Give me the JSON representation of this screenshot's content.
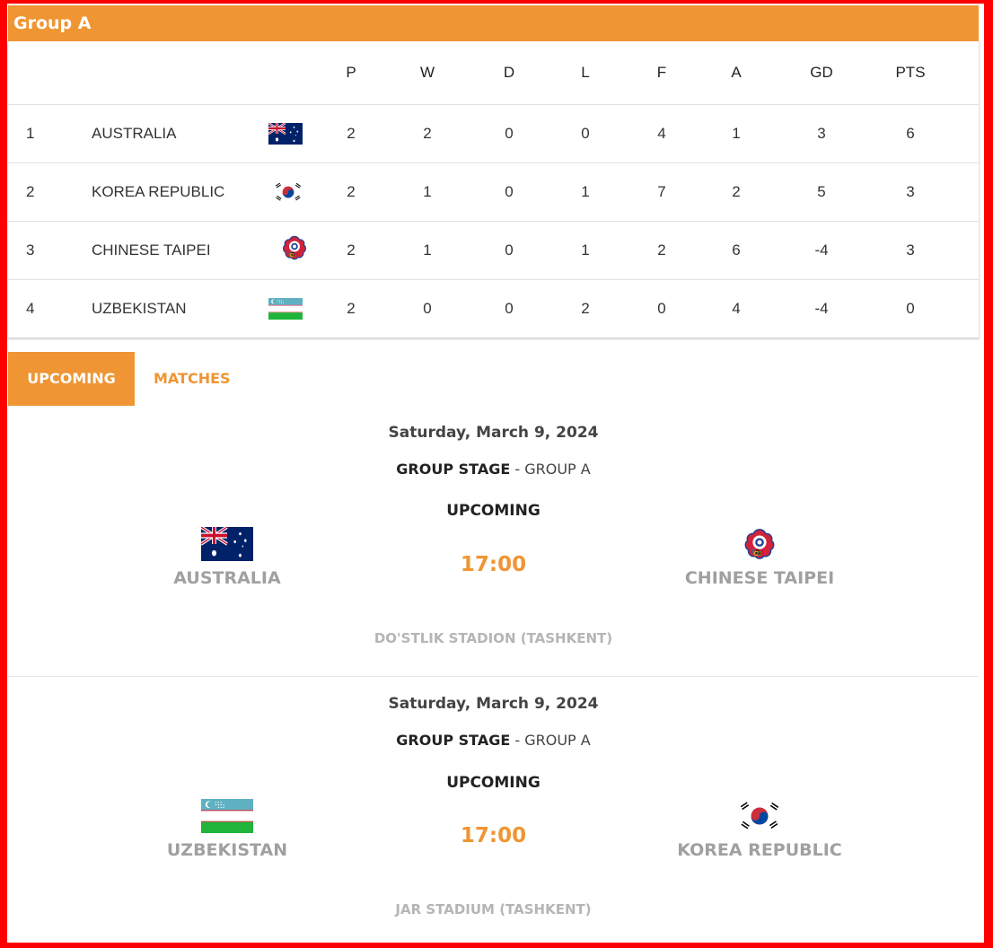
{
  "group": {
    "title": "Group A"
  },
  "columns": [
    "P",
    "W",
    "D",
    "L",
    "F",
    "A",
    "GD",
    "PTS"
  ],
  "standings": [
    {
      "rank": "1",
      "team": "AUSTRALIA",
      "flag": "australia-flag-icon",
      "P": "2",
      "W": "2",
      "D": "0",
      "L": "0",
      "F": "4",
      "A": "1",
      "GD": "3",
      "PTS": "6"
    },
    {
      "rank": "2",
      "team": "KOREA REPUBLIC",
      "flag": "korea-flag-icon",
      "P": "2",
      "W": "1",
      "D": "0",
      "L": "1",
      "F": "7",
      "A": "2",
      "GD": "5",
      "PTS": "3"
    },
    {
      "rank": "3",
      "team": "CHINESE TAIPEI",
      "flag": "chinese-taipei-flag-icon",
      "P": "2",
      "W": "1",
      "D": "0",
      "L": "1",
      "F": "2",
      "A": "6",
      "GD": "-4",
      "PTS": "3"
    },
    {
      "rank": "4",
      "team": "UZBEKISTAN",
      "flag": "uzbekistan-flag-icon",
      "P": "2",
      "W": "0",
      "D": "0",
      "L": "2",
      "F": "0",
      "A": "4",
      "GD": "-4",
      "PTS": "0"
    }
  ],
  "tabs": [
    {
      "label": "UPCOMING",
      "active": true
    },
    {
      "label": "MATCHES",
      "active": false
    }
  ],
  "matches": [
    {
      "date": "Saturday, March 9, 2024",
      "stage_bold": "GROUP STAGE",
      "stage_rest": " - GROUP A",
      "status": "UPCOMING",
      "time": "17:00",
      "home": "AUSTRALIA",
      "home_flag": "australia-flag-icon",
      "away": "CHINESE TAIPEI",
      "away_flag": "chinese-taipei-flag-icon",
      "venue": "DO'STLIK STADION (TASHKENT)"
    },
    {
      "date": "Saturday, March 9, 2024",
      "stage_bold": "GROUP STAGE",
      "stage_rest": " - GROUP A",
      "status": "UPCOMING",
      "time": "17:00",
      "home": "UZBEKISTAN",
      "home_flag": "uzbekistan-flag-icon",
      "away": "KOREA REPUBLIC",
      "away_flag": "korea-flag-icon",
      "venue": "JAR STADIUM (TASHKENT)"
    }
  ],
  "colors": {
    "accent": "#ef9533",
    "frame": "#ff0000",
    "muted": "#a0a0a0"
  }
}
